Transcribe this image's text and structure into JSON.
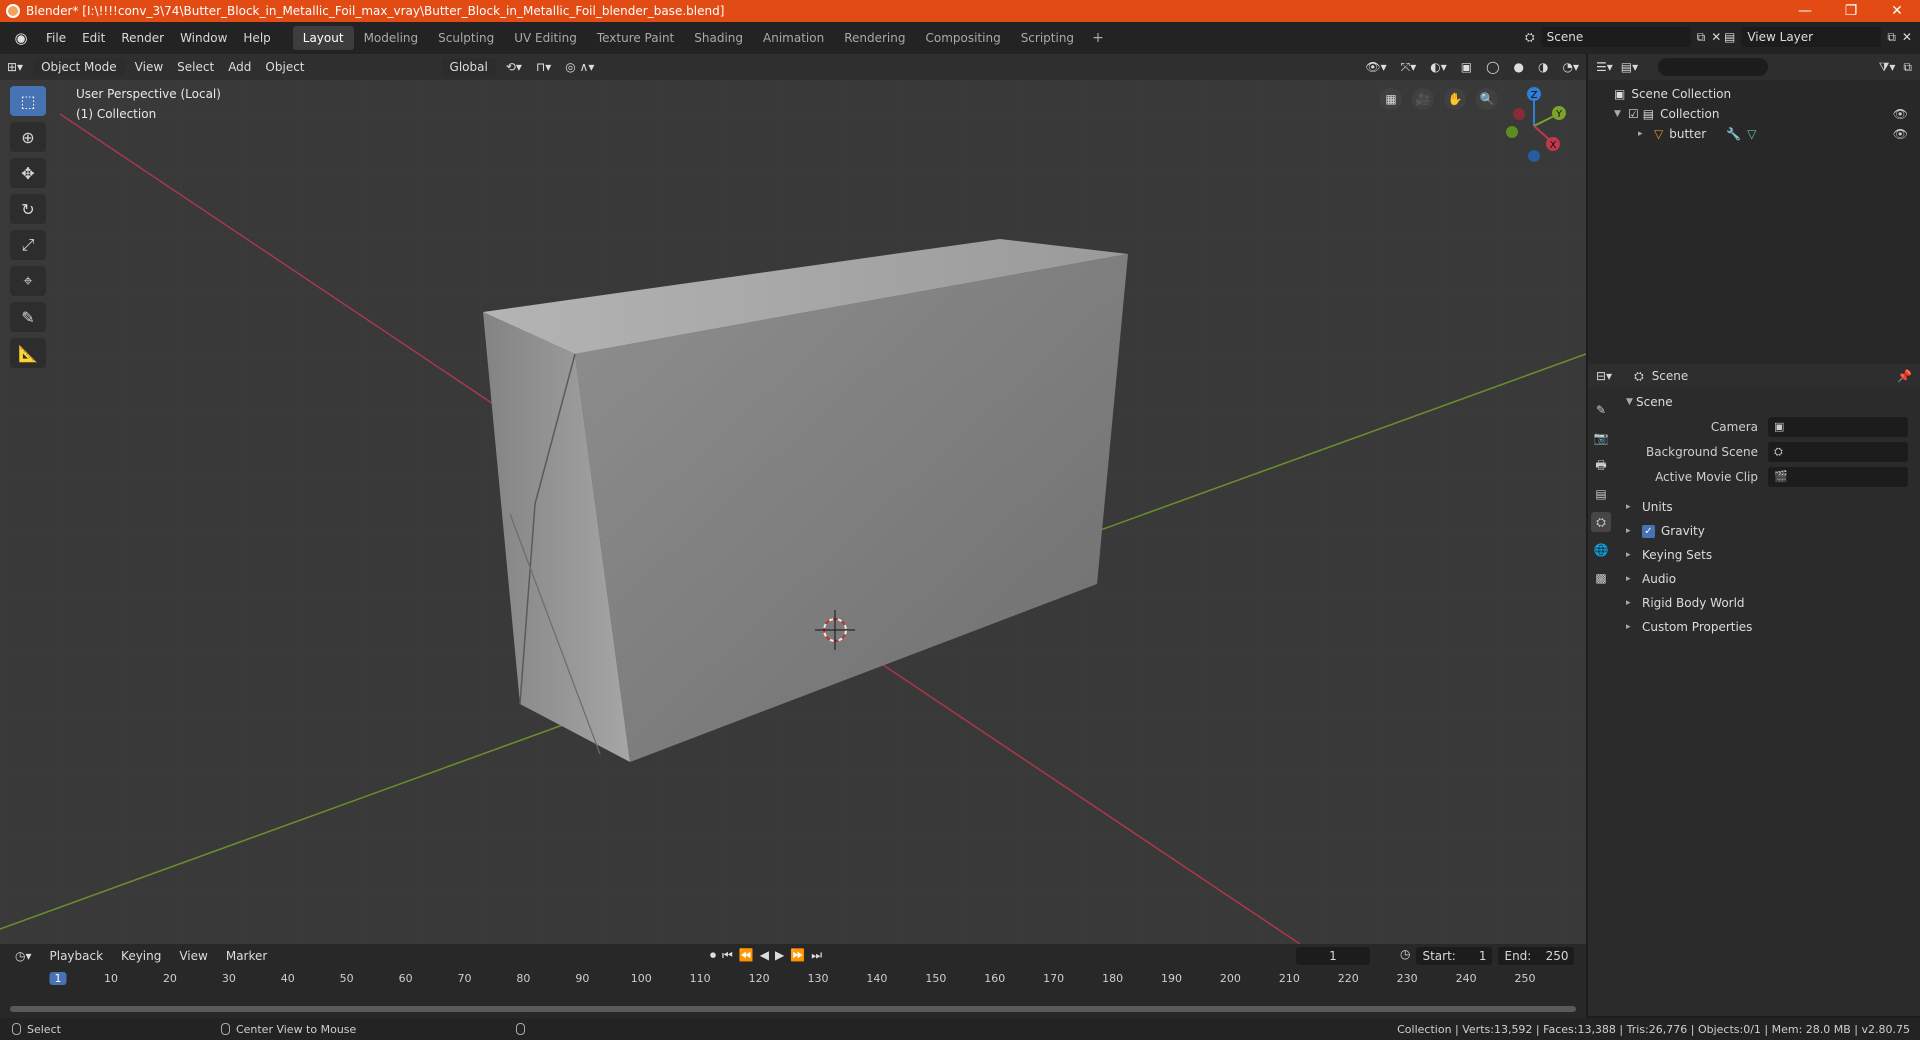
{
  "window": {
    "title": "Blender* [I:\\!!!!conv_3\\74\\Butter_Block_in_Metallic_Foil_max_vray\\Butter_Block_in_Metallic_Foil_blender_base.blend]",
    "minimize": "—",
    "maximize": "❐",
    "close": "✕"
  },
  "menu": [
    "File",
    "Edit",
    "Render",
    "Window",
    "Help"
  ],
  "workspaces": [
    "Layout",
    "Modeling",
    "Sculpting",
    "UV Editing",
    "Texture Paint",
    "Shading",
    "Animation",
    "Rendering",
    "Compositing",
    "Scripting"
  ],
  "workspace_add": "+",
  "scene_name": "Scene",
  "view_layer": "View Layer",
  "viewport": {
    "mode": "Object Mode",
    "menus": [
      "View",
      "Select",
      "Add",
      "Object"
    ],
    "orientation": "Global",
    "info_line1": "User Perspective (Local)",
    "info_line2": "(1) Collection",
    "gizmo": {
      "x": "X",
      "y": "Y",
      "z": "Z"
    }
  },
  "outliner": {
    "root": "Scene Collection",
    "collection": "Collection",
    "object": "butter"
  },
  "properties": {
    "context": "Scene",
    "panel": "Scene",
    "camera_label": "Camera",
    "bg_scene_label": "Background Scene",
    "movie_clip_label": "Active Movie Clip",
    "subpanels": [
      "Units",
      "Gravity",
      "Keying Sets",
      "Audio",
      "Rigid Body World",
      "Custom Properties"
    ]
  },
  "timeline": {
    "menus": [
      "Playback",
      "Keying",
      "View",
      "Marker"
    ],
    "current_frame": "1",
    "start_label": "Start:",
    "start": "1",
    "end_label": "End:",
    "end": "250",
    "ticks": [
      "1",
      "10",
      "20",
      "30",
      "40",
      "50",
      "60",
      "70",
      "80",
      "90",
      "100",
      "110",
      "120",
      "130",
      "140",
      "150",
      "160",
      "170",
      "180",
      "190",
      "200",
      "210",
      "220",
      "230",
      "240",
      "250"
    ]
  },
  "status": {
    "left": "Select",
    "middle": "Center View to Mouse",
    "right": "Collection | Verts:13,592 | Faces:13,388 | Tris:26,776 | Objects:0/1 | Mem: 28.0 MB | v2.80.75"
  },
  "colors": {
    "titlebar": "#e24b14",
    "accent": "#4772b3",
    "x_axis": "#c0394b",
    "y_axis": "#7aa32c",
    "z_axis": "#2f7ed8"
  }
}
